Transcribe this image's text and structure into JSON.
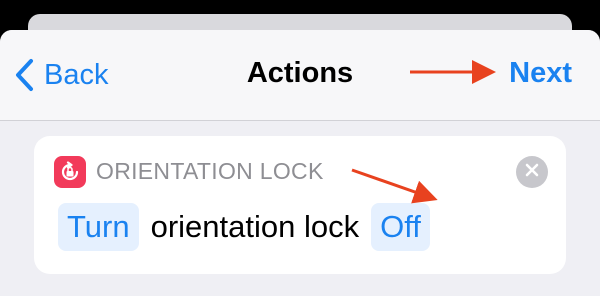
{
  "navbar": {
    "back_label": "Back",
    "title": "Actions",
    "next_label": "Next"
  },
  "action": {
    "icon": "orientation-lock-icon",
    "name": "ORIENTATION LOCK",
    "verb_token": "Turn",
    "static_text": "orientation lock",
    "state_token": "Off"
  },
  "colors": {
    "accent": "#1a82f0",
    "icon_bg": "#f23a5a",
    "annotation_arrow": "#e8421f"
  }
}
